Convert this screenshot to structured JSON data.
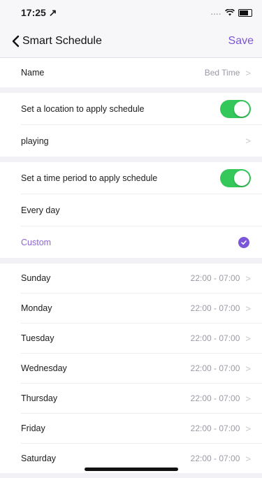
{
  "status": {
    "time": "17:25",
    "dots": "....",
    "location_arrow": "↗"
  },
  "nav": {
    "back_label": "Smart Schedule",
    "save_label": "Save"
  },
  "name_row": {
    "label": "Name",
    "value": "Bed Time"
  },
  "location": {
    "label": "Set a location to apply schedule",
    "toggle_on": true,
    "place": "playing"
  },
  "time_period": {
    "label": "Set a time period to apply schedule",
    "toggle_on": true,
    "every_day": "Every day",
    "custom": "Custom"
  },
  "days": [
    {
      "day": "Sunday",
      "time": "22:00 - 07:00"
    },
    {
      "day": "Monday",
      "time": "22:00 - 07:00"
    },
    {
      "day": "Tuesday",
      "time": "22:00 - 07:00"
    },
    {
      "day": "Wednesday",
      "time": "22:00 - 07:00"
    },
    {
      "day": "Thursday",
      "time": "22:00 - 07:00"
    },
    {
      "day": "Friday",
      "time": "22:00 - 07:00"
    },
    {
      "day": "Saturday",
      "time": "22:00 - 07:00"
    }
  ],
  "colors": {
    "accent": "#7b56d8",
    "toggle": "#34c759"
  }
}
